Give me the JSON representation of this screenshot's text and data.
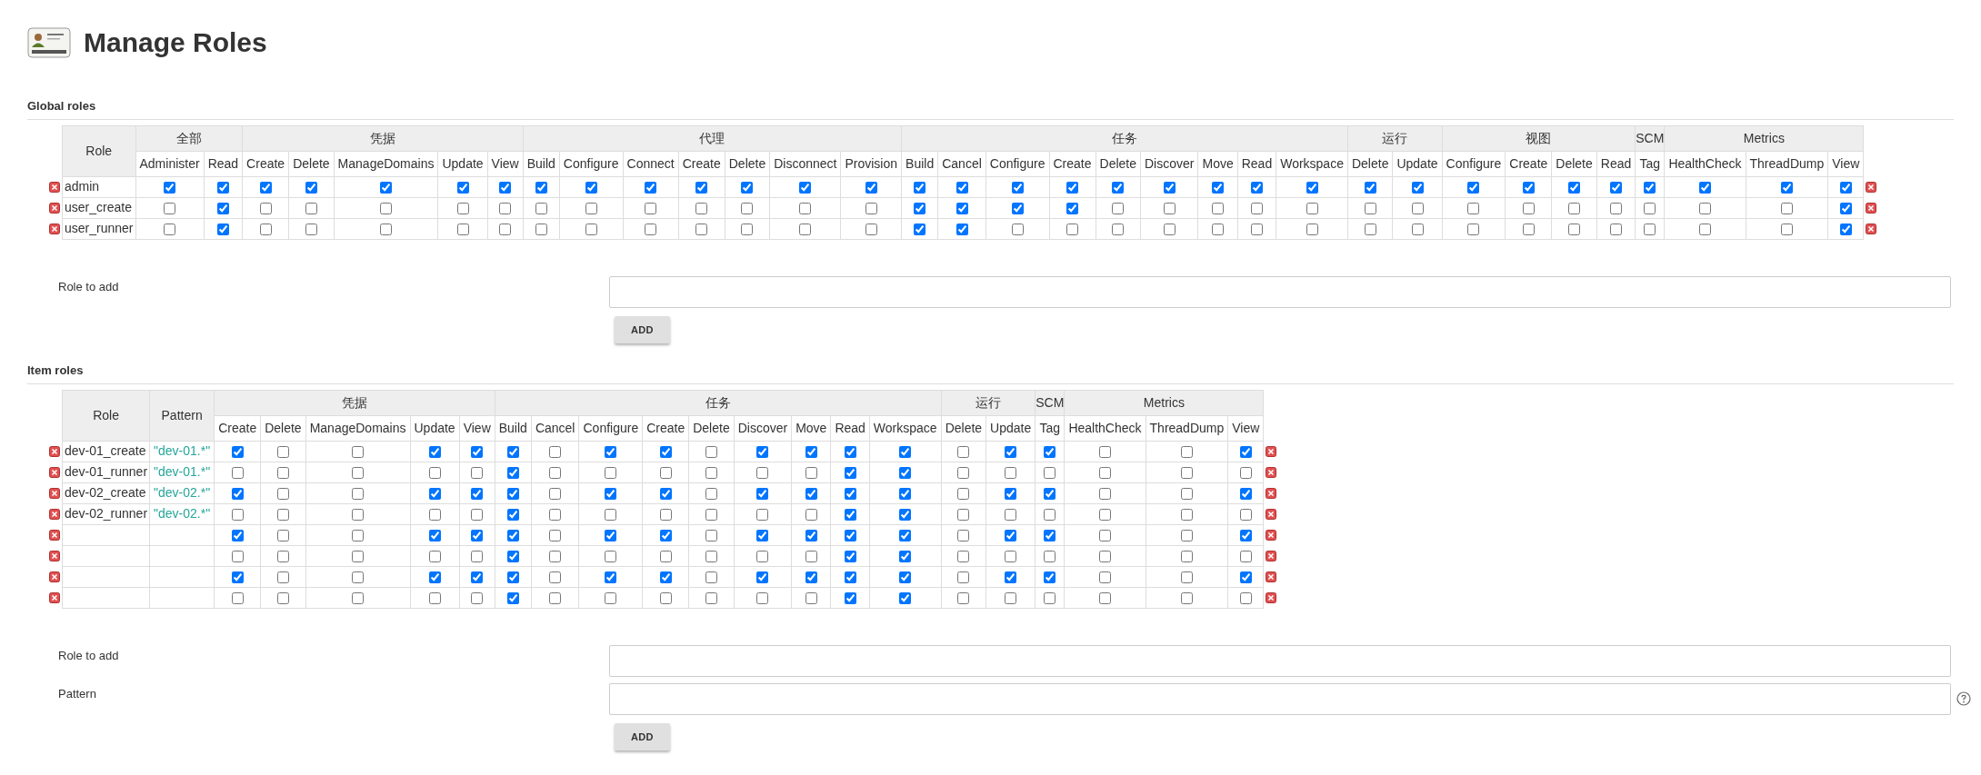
{
  "title": "Manage Roles",
  "global_roles": {
    "heading": "Global roles",
    "role_header": "Role",
    "groups": [
      {
        "name": "全部",
        "permissions": [
          "Administer",
          "Read"
        ]
      },
      {
        "name": "凭据",
        "permissions": [
          "Create",
          "Delete",
          "ManageDomains",
          "Update",
          "View"
        ]
      },
      {
        "name": "代理",
        "permissions": [
          "Build",
          "Configure",
          "Connect",
          "Create",
          "Delete",
          "Disconnect",
          "Provision"
        ]
      },
      {
        "name": "任务",
        "permissions": [
          "Build",
          "Cancel",
          "Configure",
          "Create",
          "Delete",
          "Discover",
          "Move",
          "Read",
          "Workspace"
        ]
      },
      {
        "name": "运行",
        "permissions": [
          "Delete",
          "Update"
        ]
      },
      {
        "name": "视图",
        "permissions": [
          "Configure",
          "Create",
          "Delete",
          "Read"
        ]
      },
      {
        "name": "SCM",
        "permissions": [
          "Tag"
        ]
      },
      {
        "name": "Metrics",
        "permissions": [
          "HealthCheck",
          "ThreadDump",
          "View"
        ]
      }
    ],
    "rows": [
      {
        "role": "admin",
        "checked": [
          true,
          true,
          true,
          true,
          true,
          true,
          true,
          true,
          true,
          true,
          true,
          true,
          true,
          true,
          true,
          true,
          true,
          true,
          true,
          true,
          true,
          true,
          true,
          true,
          true,
          true,
          true,
          true,
          true,
          true,
          true,
          true,
          true
        ]
      },
      {
        "role": "user_create",
        "checked": [
          false,
          true,
          false,
          false,
          false,
          false,
          false,
          false,
          false,
          false,
          false,
          false,
          false,
          false,
          true,
          true,
          true,
          true,
          false,
          false,
          false,
          false,
          false,
          false,
          false,
          false,
          false,
          false,
          false,
          false,
          false,
          false,
          true
        ]
      },
      {
        "role": "user_runner",
        "checked": [
          false,
          true,
          false,
          false,
          false,
          false,
          false,
          false,
          false,
          false,
          false,
          false,
          false,
          false,
          true,
          true,
          false,
          false,
          false,
          false,
          false,
          false,
          false,
          false,
          false,
          false,
          false,
          false,
          false,
          false,
          false,
          false,
          true
        ]
      }
    ]
  },
  "global_add": {
    "fields": [
      {
        "label": "Role to add",
        "help": false
      }
    ],
    "button": "ADD"
  },
  "item_roles": {
    "heading": "Item roles",
    "role_header": "Role",
    "pattern_header": "Pattern",
    "groups": [
      {
        "name": "凭据",
        "permissions": [
          "Create",
          "Delete",
          "ManageDomains",
          "Update",
          "View"
        ]
      },
      {
        "name": "任务",
        "permissions": [
          "Build",
          "Cancel",
          "Configure",
          "Create",
          "Delete",
          "Discover",
          "Move",
          "Read",
          "Workspace"
        ]
      },
      {
        "name": "运行",
        "permissions": [
          "Delete",
          "Update"
        ]
      },
      {
        "name": "SCM",
        "permissions": [
          "Tag"
        ]
      },
      {
        "name": "Metrics",
        "permissions": [
          "HealthCheck",
          "ThreadDump",
          "View"
        ]
      }
    ],
    "rows": [
      {
        "role": "dev-01_create",
        "pattern": "\"dev-01.*\"",
        "checked": [
          true,
          false,
          false,
          true,
          true,
          true,
          false,
          true,
          true,
          false,
          true,
          true,
          true,
          true,
          false,
          true,
          true,
          false,
          false,
          true
        ]
      },
      {
        "role": "dev-01_runner",
        "pattern": "\"dev-01.*\"",
        "checked": [
          false,
          false,
          false,
          false,
          false,
          true,
          false,
          false,
          false,
          false,
          false,
          false,
          true,
          true,
          false,
          false,
          false,
          false,
          false,
          false
        ]
      },
      {
        "role": "dev-02_create",
        "pattern": "\"dev-02.*\"",
        "checked": [
          true,
          false,
          false,
          true,
          true,
          true,
          false,
          true,
          true,
          false,
          true,
          true,
          true,
          true,
          false,
          true,
          true,
          false,
          false,
          true
        ]
      },
      {
        "role": "dev-02_runner",
        "pattern": "\"dev-02.*\"",
        "checked": [
          false,
          false,
          false,
          false,
          false,
          true,
          false,
          false,
          false,
          false,
          false,
          false,
          true,
          true,
          false,
          false,
          false,
          false,
          false,
          false
        ]
      },
      {
        "checked": [
          true,
          false,
          false,
          true,
          true,
          true,
          false,
          true,
          true,
          false,
          true,
          true,
          true,
          true,
          false,
          true,
          true,
          false,
          false,
          true
        ]
      },
      {
        "checked": [
          false,
          false,
          false,
          false,
          false,
          true,
          false,
          false,
          false,
          false,
          false,
          false,
          true,
          true,
          false,
          false,
          false,
          false,
          false,
          false
        ]
      },
      {
        "checked": [
          true,
          false,
          false,
          true,
          true,
          true,
          false,
          true,
          true,
          false,
          true,
          true,
          true,
          true,
          false,
          true,
          true,
          false,
          false,
          true
        ]
      },
      {
        "checked": [
          false,
          false,
          false,
          false,
          false,
          true,
          false,
          false,
          false,
          false,
          false,
          false,
          true,
          true,
          false,
          false,
          false,
          false,
          false,
          false
        ]
      }
    ]
  },
  "item_add": {
    "fields": [
      {
        "label": "Role to add",
        "help": false
      },
      {
        "label": "Pattern",
        "help": true
      }
    ],
    "button": "ADD"
  }
}
